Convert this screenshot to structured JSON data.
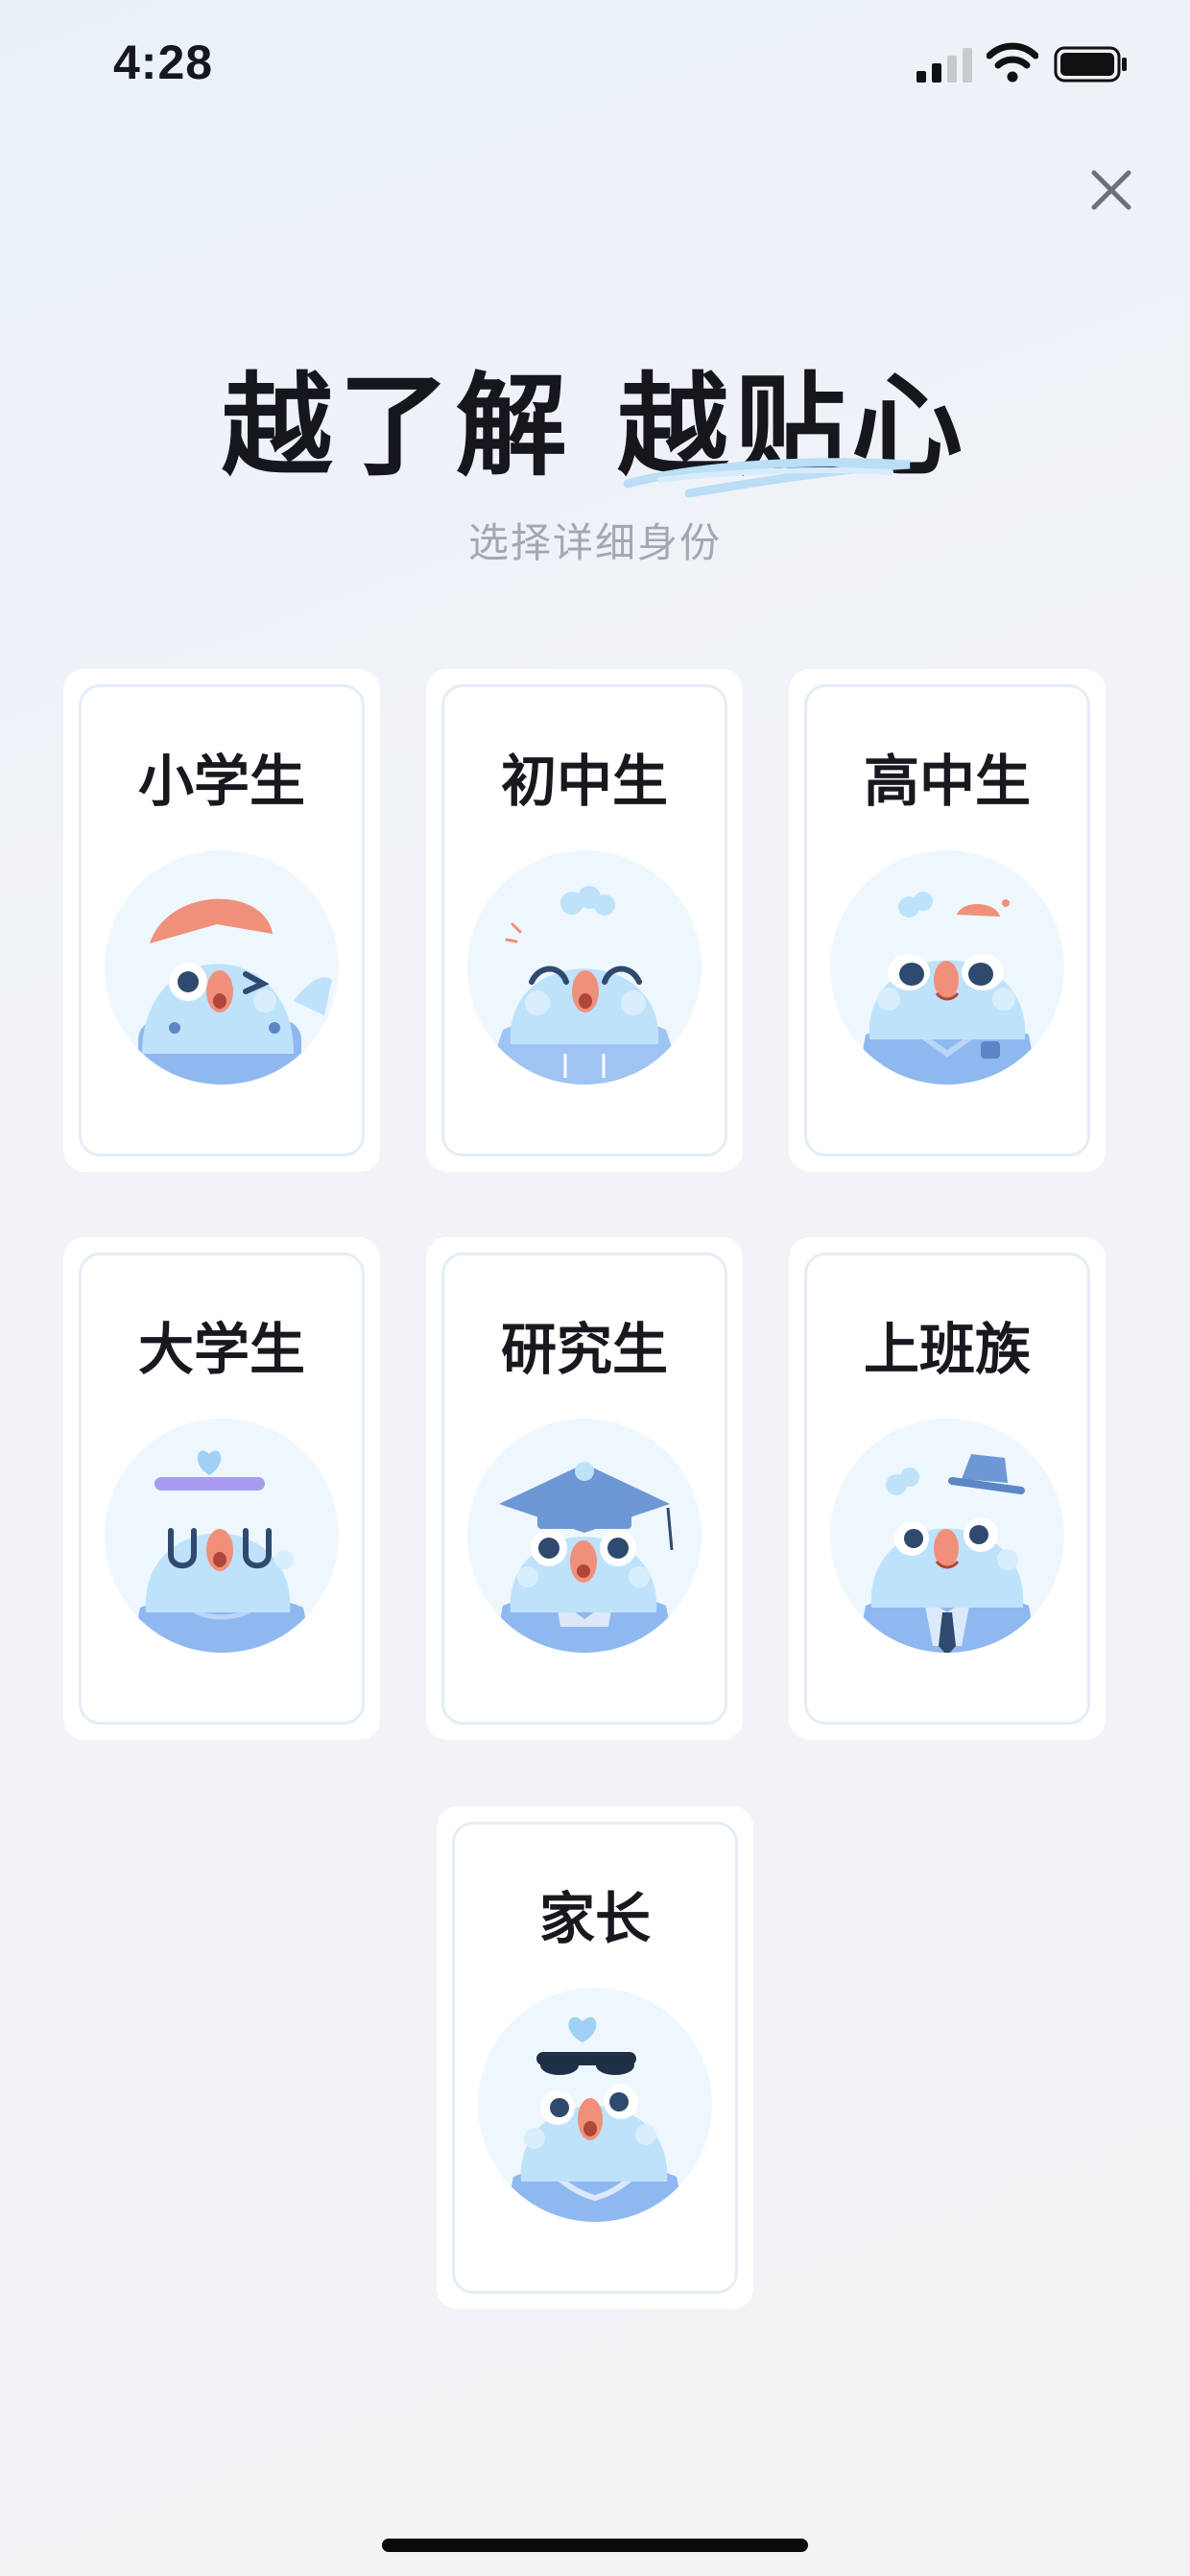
{
  "status_bar": {
    "time": "4:28"
  },
  "header": {
    "title": "越了解 越贴心",
    "subtitle": "选择详细身份"
  },
  "identities": [
    {
      "label": "小学生",
      "icon": "elementary-student-avatar-icon"
    },
    {
      "label": "初中生",
      "icon": "middle-school-student-avatar-icon"
    },
    {
      "label": "高中生",
      "icon": "high-school-student-avatar-icon"
    },
    {
      "label": "大学生",
      "icon": "college-student-avatar-icon"
    },
    {
      "label": "研究生",
      "icon": "graduate-student-avatar-icon"
    },
    {
      "label": "上班族",
      "icon": "office-worker-avatar-icon"
    },
    {
      "label": "家长",
      "icon": "parent-avatar-icon"
    }
  ],
  "colors": {
    "bird_body": "#bfe2fb",
    "shirt": "#8fb8f0",
    "beak": "#f0907a",
    "avatar_bg": "#eef7fd",
    "accent_swoosh": "#b9def6"
  }
}
